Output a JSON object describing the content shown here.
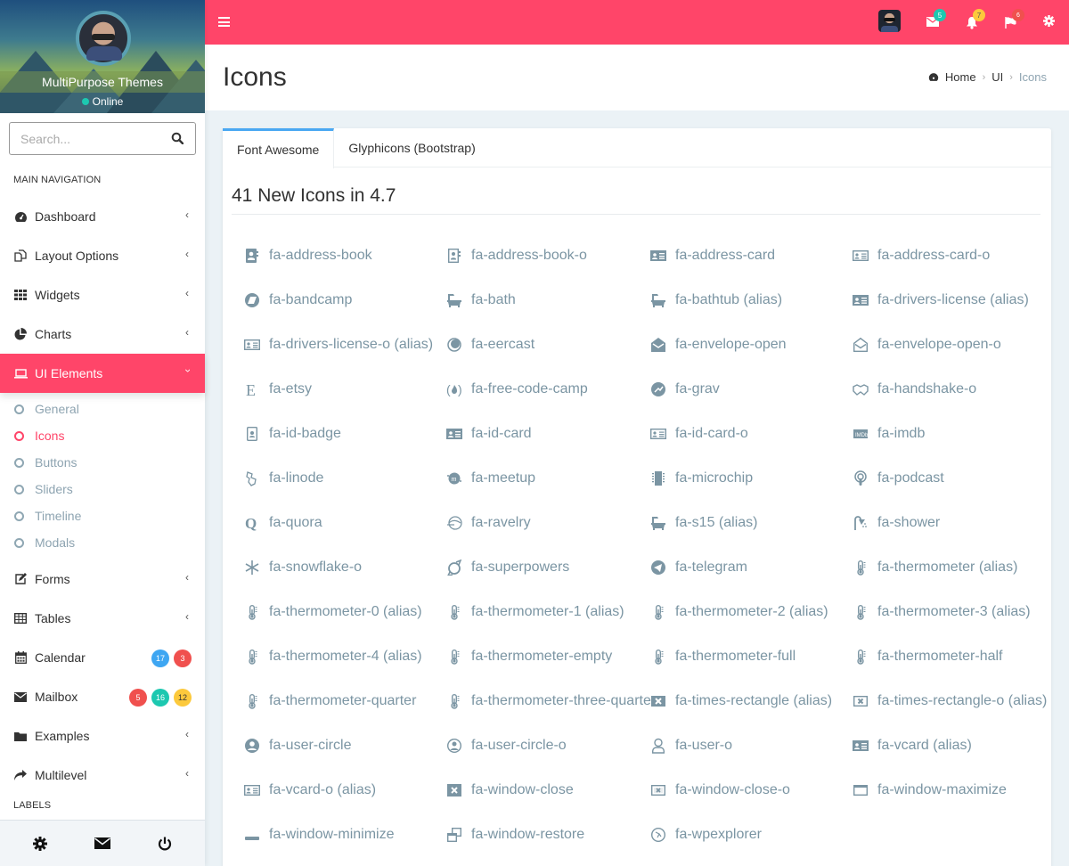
{
  "colors": {
    "accent": "#ff4569",
    "tab_active": "#4aa8f2",
    "icon_text": "#7b95a3",
    "submenu_text": "#8ea4b1",
    "badge_blue": "#3ea6f2",
    "badge_red": "#f0504e",
    "badge_teal": "#1dc8b0",
    "badge_yellow": "#fcc93c"
  },
  "user": {
    "name": "MultiPurpose Themes",
    "status": "Online"
  },
  "search": {
    "placeholder": "Search..."
  },
  "sidebar": {
    "main_header": "MAIN NAVIGATION",
    "labels_header": "LABELS",
    "items": [
      {
        "label": "Dashboard",
        "icon": "dashboard-icon"
      },
      {
        "label": "Layout Options",
        "icon": "files-icon"
      },
      {
        "label": "Widgets",
        "icon": "th-icon"
      },
      {
        "label": "Charts",
        "icon": "pie-chart-icon"
      },
      {
        "label": "UI Elements",
        "icon": "laptop-icon",
        "active": true,
        "children": [
          "General",
          "Icons",
          "Buttons",
          "Sliders",
          "Timeline",
          "Modals"
        ],
        "current_child": "Icons"
      },
      {
        "label": "Forms",
        "icon": "edit-icon"
      },
      {
        "label": "Tables",
        "icon": "table-icon"
      },
      {
        "label": "Calendar",
        "icon": "calendar-icon",
        "badges": [
          "17",
          "3"
        ]
      },
      {
        "label": "Mailbox",
        "icon": "envelope-icon",
        "badges": [
          "5",
          "16",
          "12"
        ]
      },
      {
        "label": "Examples",
        "icon": "folder-icon"
      },
      {
        "label": "Multilevel",
        "icon": "share-icon"
      }
    ],
    "footer": [
      "settings-icon",
      "envelope-icon",
      "power-icon"
    ]
  },
  "topbar": {
    "messages_count": "5",
    "notifications_count": "7",
    "tasks_count": "6"
  },
  "header": {
    "title": "Icons",
    "breadcrumb": [
      "Home",
      "UI",
      "Icons"
    ]
  },
  "tabs": [
    {
      "label": "Font Awesome",
      "active": true
    },
    {
      "label": "Glyphicons (Bootstrap)",
      "active": false
    }
  ],
  "section": {
    "title": "41 New Icons in 4.7"
  },
  "icons": [
    {
      "name": "fa-address-book",
      "alias": ""
    },
    {
      "name": "fa-address-book-o",
      "alias": ""
    },
    {
      "name": "fa-address-card",
      "alias": ""
    },
    {
      "name": "fa-address-card-o",
      "alias": ""
    },
    {
      "name": "fa-bandcamp",
      "alias": ""
    },
    {
      "name": "fa-bath",
      "alias": ""
    },
    {
      "name": "fa-bathtub",
      "alias": "(alias)"
    },
    {
      "name": "fa-drivers-license",
      "alias": "(alias)"
    },
    {
      "name": "fa-drivers-license-o",
      "alias": "(alias)"
    },
    {
      "name": "fa-eercast",
      "alias": ""
    },
    {
      "name": "fa-envelope-open",
      "alias": ""
    },
    {
      "name": "fa-envelope-open-o",
      "alias": ""
    },
    {
      "name": "fa-etsy",
      "alias": ""
    },
    {
      "name": "fa-free-code-camp",
      "alias": ""
    },
    {
      "name": "fa-grav",
      "alias": ""
    },
    {
      "name": "fa-handshake-o",
      "alias": ""
    },
    {
      "name": "fa-id-badge",
      "alias": ""
    },
    {
      "name": "fa-id-card",
      "alias": ""
    },
    {
      "name": "fa-id-card-o",
      "alias": ""
    },
    {
      "name": "fa-imdb",
      "alias": ""
    },
    {
      "name": "fa-linode",
      "alias": ""
    },
    {
      "name": "fa-meetup",
      "alias": ""
    },
    {
      "name": "fa-microchip",
      "alias": ""
    },
    {
      "name": "fa-podcast",
      "alias": ""
    },
    {
      "name": "fa-quora",
      "alias": ""
    },
    {
      "name": "fa-ravelry",
      "alias": ""
    },
    {
      "name": "fa-s15",
      "alias": "(alias)"
    },
    {
      "name": "fa-shower",
      "alias": ""
    },
    {
      "name": "fa-snowflake-o",
      "alias": ""
    },
    {
      "name": "fa-superpowers",
      "alias": ""
    },
    {
      "name": "fa-telegram",
      "alias": ""
    },
    {
      "name": "fa-thermometer",
      "alias": "(alias)"
    },
    {
      "name": "fa-thermometer-0",
      "alias": "(alias)"
    },
    {
      "name": "fa-thermometer-1",
      "alias": "(alias)"
    },
    {
      "name": "fa-thermometer-2",
      "alias": "(alias)"
    },
    {
      "name": "fa-thermometer-3",
      "alias": "(alias)"
    },
    {
      "name": "fa-thermometer-4",
      "alias": "(alias)"
    },
    {
      "name": "fa-thermometer-empty",
      "alias": ""
    },
    {
      "name": "fa-thermometer-full",
      "alias": ""
    },
    {
      "name": "fa-thermometer-half",
      "alias": ""
    },
    {
      "name": "fa-thermometer-quarter",
      "alias": ""
    },
    {
      "name": "fa-thermometer-three-quarters",
      "alias": ""
    },
    {
      "name": "fa-times-rectangle",
      "alias": "(alias)"
    },
    {
      "name": "fa-times-rectangle-o",
      "alias": "(alias)"
    },
    {
      "name": "fa-user-circle",
      "alias": ""
    },
    {
      "name": "fa-user-circle-o",
      "alias": ""
    },
    {
      "name": "fa-user-o",
      "alias": ""
    },
    {
      "name": "fa-vcard",
      "alias": "(alias)"
    },
    {
      "name": "fa-vcard-o",
      "alias": "(alias)"
    },
    {
      "name": "fa-window-close",
      "alias": ""
    },
    {
      "name": "fa-window-close-o",
      "alias": ""
    },
    {
      "name": "fa-window-maximize",
      "alias": ""
    },
    {
      "name": "fa-window-minimize",
      "alias": ""
    },
    {
      "name": "fa-window-restore",
      "alias": ""
    },
    {
      "name": "fa-wpexplorer",
      "alias": ""
    }
  ]
}
